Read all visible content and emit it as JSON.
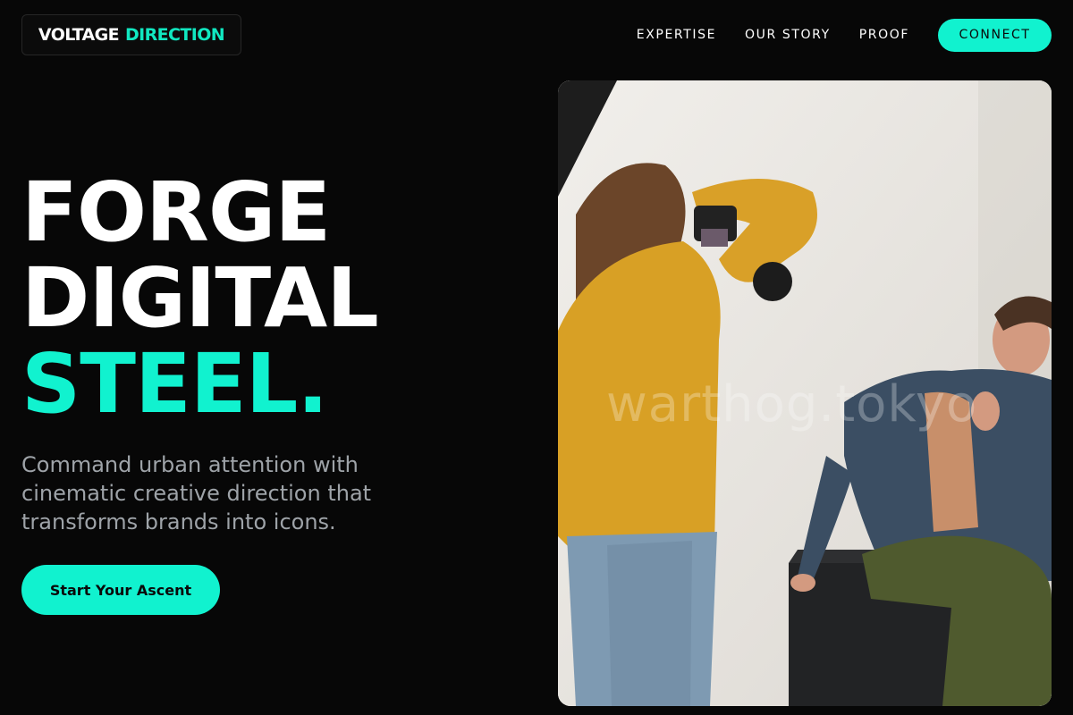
{
  "brand": {
    "part1": "VOLTAGE",
    "part2": "DIRECTION"
  },
  "nav": {
    "items": [
      "EXPERTISE",
      "OUR STORY",
      "PROOF"
    ],
    "cta_label": "CONNECT"
  },
  "hero": {
    "headline_lines": [
      "FORGE",
      "DIGITAL"
    ],
    "headline_accent": "STEEL.",
    "subtext_lines": [
      "Command urban attention with",
      "cinematic creative direction that",
      "transforms brands into icons."
    ],
    "cta_label": "Start Your Ascent",
    "image_watermark": "warthog.tokyo"
  },
  "colors": {
    "accent": "#11f2cf",
    "background": "#070707",
    "muted_text": "#9ea3a8"
  }
}
